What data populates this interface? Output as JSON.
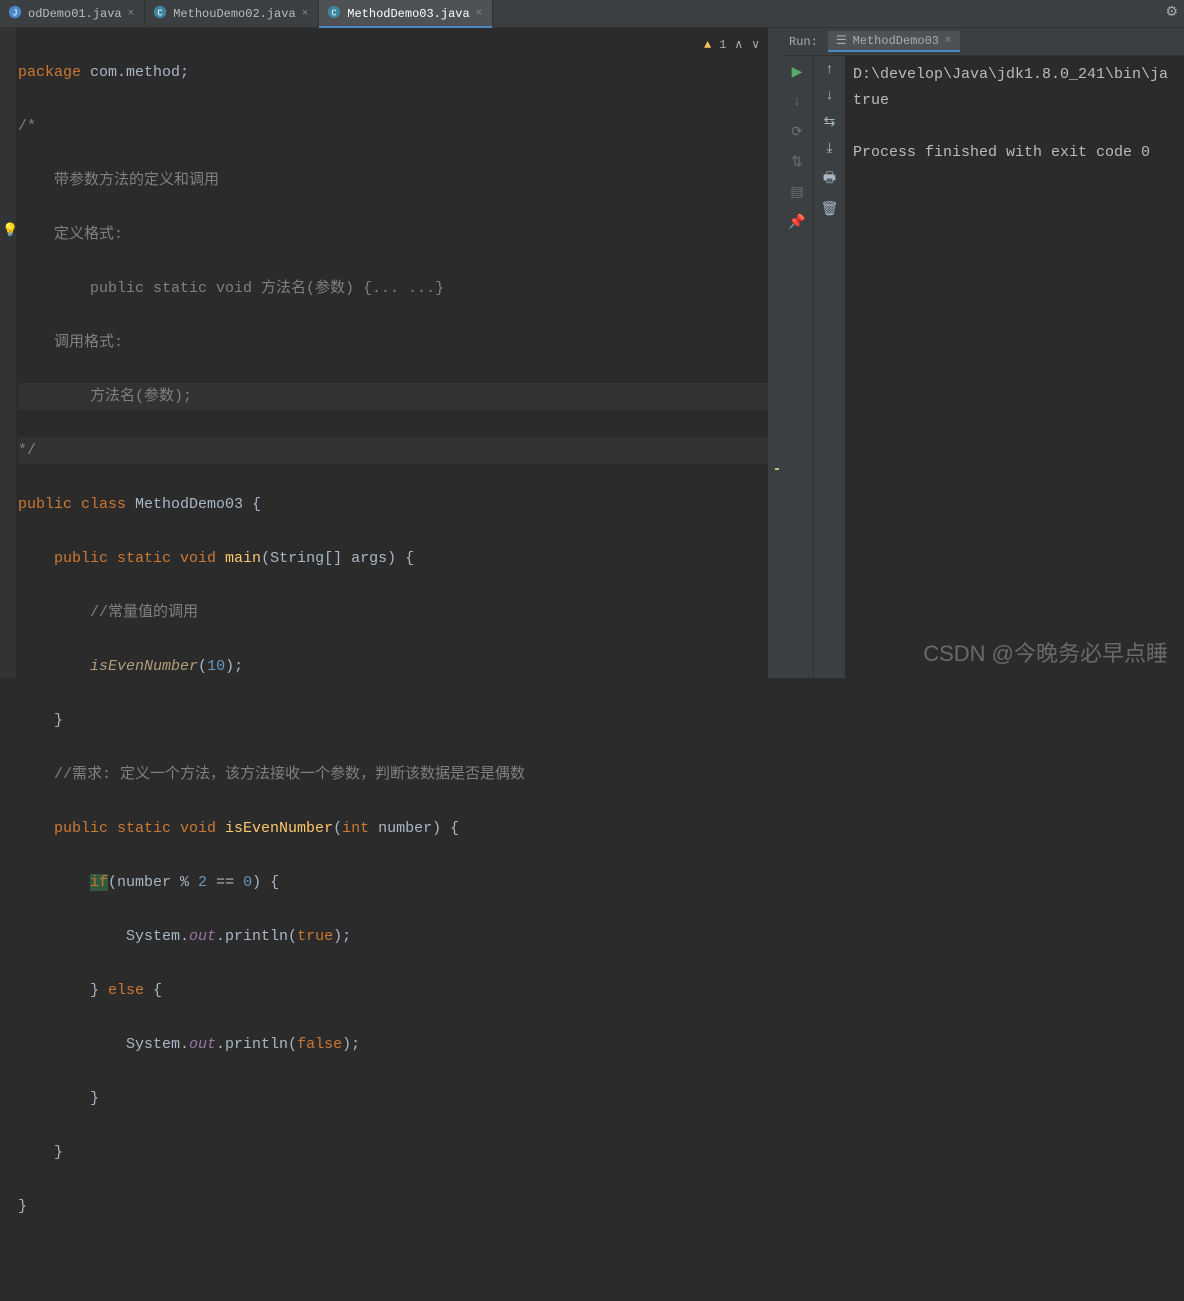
{
  "tabs": [
    {
      "label": "odDemo01.java",
      "active": false
    },
    {
      "label": "MethouDemo02.java",
      "active": false
    },
    {
      "label": "MethodDemo03.java",
      "active": true
    }
  ],
  "warnings": {
    "count": "1"
  },
  "code": {
    "l1a": "package",
    "l1b": " com.method;",
    "l2": "/*",
    "l3": "    带参数方法的定义和调用",
    "l4": "    定义格式:",
    "l5a": "        public static void ",
    "l5b": "方法名(参数) {... ...}",
    "l6": "    调用格式:",
    "l7": "        方法名(参数);",
    "l8": "*/",
    "l9a": "public class ",
    "l9b": "MethodDemo03 {",
    "l10a": "    public static void ",
    "l10b": "main",
    "l10c": "(String[] args) {",
    "l11": "        //常量值的调用",
    "l12a": "        ",
    "l12b": "isEvenNumber",
    "l12c": "(",
    "l12d": "10",
    "l12e": ");",
    "l13": "    }",
    "l14": "    //需求: 定义一个方法，该方法接收一个参数，判断该数据是否是偶数",
    "l15a": "    public static void ",
    "l15b": "isEvenNumber",
    "l15c": "(",
    "l15d": "int",
    "l15e": " number) {",
    "l16a": "        ",
    "l16b": "if",
    "l16c": "(number % ",
    "l16d": "2",
    "l16e": " == ",
    "l16f": "0",
    "l16g": ") {",
    "l17a": "            System.",
    "l17b": "out",
    "l17c": ".println(",
    "l17d": "true",
    "l17e": ");",
    "l18a": "        } ",
    "l18b": "else",
    "l18c": " {",
    "l19a": "            System.",
    "l19b": "out",
    "l19c": ".println(",
    "l19d": "false",
    "l19e": ");",
    "l20": "        }",
    "l21": "    }",
    "l22": "}"
  },
  "run": {
    "label": "Run:",
    "config": "MethodDemo03",
    "out1": "D:\\develop\\Java\\jdk1.8.0_241\\bin\\ja",
    "out2": "true",
    "out3": "",
    "out4": "Process finished with exit code 0"
  },
  "watermark": "CSDN @今晚务必早点睡"
}
